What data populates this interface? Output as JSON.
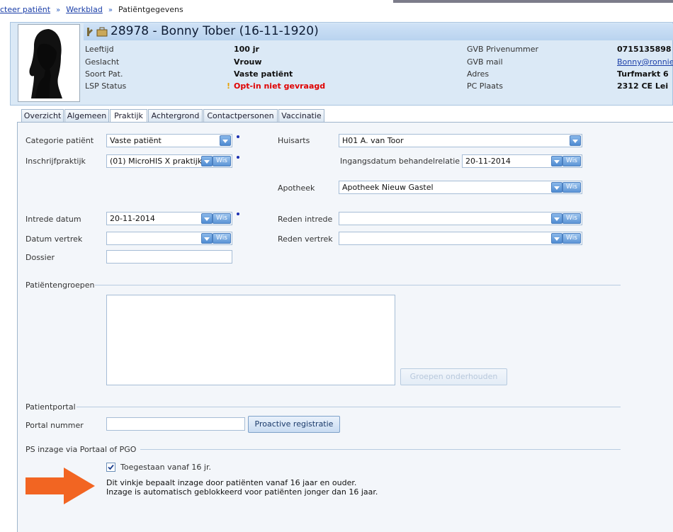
{
  "breadcrumb": {
    "item1": "cteer patiënt",
    "item2": "Werkblad",
    "item3": "Patiëntgegevens",
    "separator": "»"
  },
  "patient": {
    "title": "28978 - Bonny Tober (16-11-1920)",
    "leeftijd_label": "Leeftijd",
    "leeftijd": "100 jr",
    "geslacht_label": "Geslacht",
    "geslacht": "Vrouw",
    "soort_label": "Soort Pat.",
    "soort": "Vaste patiënt",
    "lsp_label": "LSP Status",
    "lsp": "Opt-in niet gevraagd",
    "lsp_mark": "!",
    "gvb_nr_label": "GVB Privenummer",
    "gvb_nr": "0715135898",
    "gvb_mail_label": "GVB mail",
    "gvb_mail": "Bonny@ronnie",
    "adres_label": "Adres",
    "adres": "Turfmarkt 6",
    "pc_label": "PC Plaats",
    "pc": "2312 CE Lei"
  },
  "tabs": [
    "Overzicht",
    "Algemeen",
    "Praktijk",
    "Achtergrond",
    "Contactpersonen",
    "Vaccinatie"
  ],
  "active_tab": "Praktijk",
  "form": {
    "categorie_label": "Categorie patiënt",
    "categorie": "Vaste patiënt",
    "inschrijf_label": "Inschrijfpraktijk",
    "inschrijf": "(01) MicroHIS X praktijk",
    "huisarts_label": "Huisarts",
    "huisarts": "H01  A. van Toor",
    "ingang_label": "Ingangsdatum behandelrelatie",
    "ingang": "20-11-2014",
    "apotheek_label": "Apotheek",
    "apotheek": "Apotheek Nieuw Gastel",
    "intrede_label": "Intrede datum",
    "intrede": "20-11-2014",
    "reden_intrede_label": "Reden intrede",
    "vertrek_label": "Datum vertrek",
    "reden_vertrek_label": "Reden vertrek",
    "dossier_label": "Dossier",
    "wis": "Wis"
  },
  "groepen": {
    "section": "Patiëntengroepen",
    "button": "Groepen onderhouden"
  },
  "portal": {
    "section": "Patientportal",
    "nummer_label": "Portal nummer",
    "button": "Proactive registratie"
  },
  "inzage": {
    "section": "PS inzage via Portaal of PGO",
    "checkbox_label": "Toegestaan vanaf 16 jr.",
    "checked": true,
    "info_line1": "Dit vinkje bepaalt inzage door patiënten vanaf 16 jaar en ouder.",
    "info_line2": "Inzage is automatisch geblokkeerd voor patiënten jonger dan 16 jaar."
  },
  "colors": {
    "accent": "#4f8bd1",
    "warning": "#e00000",
    "arrow": "#f26522"
  }
}
